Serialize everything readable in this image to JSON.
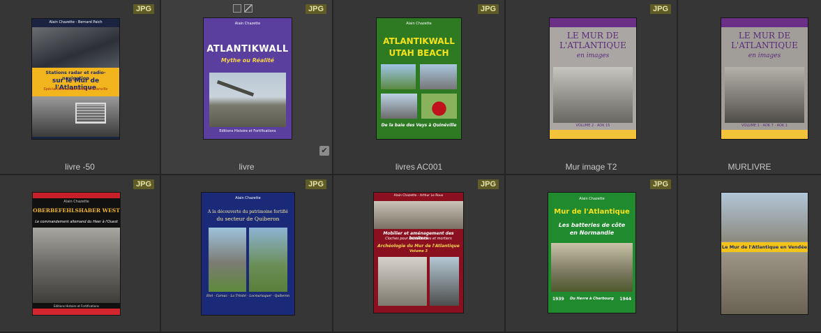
{
  "file_type_badge": "JPG",
  "thumbnails": [
    {
      "caption": "livre -50",
      "badge": "JPG",
      "cover": {
        "title_line1": "Stations radar et radio-navigation",
        "title_line2": "sur le Mur de l'Atlantique",
        "subtitle": "Spécial Normandie d'Ault à Granville",
        "authors": "Alain Chazette - Bernard Paich"
      }
    },
    {
      "caption": "livre",
      "badge": "JPG",
      "selected": true,
      "cover": {
        "authors": "Alain Chazette",
        "title": "ATLANTIKWALL",
        "subtitle": "Mythe ou Réalité",
        "publisher": "Editions Histoire et Fortifications"
      }
    },
    {
      "caption": "livres AC001",
      "badge": "JPG",
      "cover": {
        "title_line1": "ATLANTIKWALL",
        "title_line2": "UTAH BEACH",
        "footer": "De la baie des Veys à Quinéville",
        "authors": "Alain Chazette"
      }
    },
    {
      "caption": "Mur image T2",
      "badge": "JPG",
      "cover": {
        "title_line1": "LE MUR DE",
        "title_line2": "L'ATLANTIQUE",
        "subtitle": "en images",
        "volume": "VOLUME 2 · AOK 15"
      }
    },
    {
      "caption": "MURLIVRE",
      "badge": "",
      "cover": {
        "title_line1": "LE MUR DE",
        "title_line2": "L'ATLANTIQUE",
        "subtitle": "en images",
        "volume": "VOLUME 1 · AOK 7 · AOK 1"
      }
    },
    {
      "caption": "",
      "badge": "JPG",
      "cover": {
        "authors": "Alain Chazette",
        "title": "OBERBEFEHLSHABER WEST",
        "subtitle": "Le commandement allemand du Heer à l'Ouest",
        "publisher": "Editions Histoire et Fortifications"
      }
    },
    {
      "caption": "",
      "badge": "JPG",
      "cover": {
        "authors": "Alain Chazette",
        "title_line1": "A la découverte du patrimoine fortifié",
        "title_line2": "du secteur de Quiberon",
        "footer": "Etel - Carnac - La Trinité - Locmariaquer - Quiberon"
      }
    },
    {
      "caption": "",
      "badge": "JPG",
      "cover": {
        "authors": "Alain Chazette - Arthur Le Roux",
        "title_line1": "Mobilier et aménagement des bunkers",
        "title_line2": "Cloches pour mitrailleuses et mortiers",
        "title_line3": "Archéologie du Mur de l'Atlantique",
        "volume": "Volume 3"
      }
    },
    {
      "caption": "",
      "badge": "JPG",
      "cover": {
        "authors": "Alain Chazette",
        "title_line1": "Mur de l'Atlantique",
        "title_line2": "Les batteries de côte",
        "title_line3": "en Normandie",
        "year_left": "1939",
        "year_right": "1944",
        "footer": "Du Havre à Cherbourg"
      }
    },
    {
      "caption": "",
      "badge": "",
      "cover": {
        "title": "Le Mur de l'Atlantique en Vendée"
      }
    }
  ]
}
